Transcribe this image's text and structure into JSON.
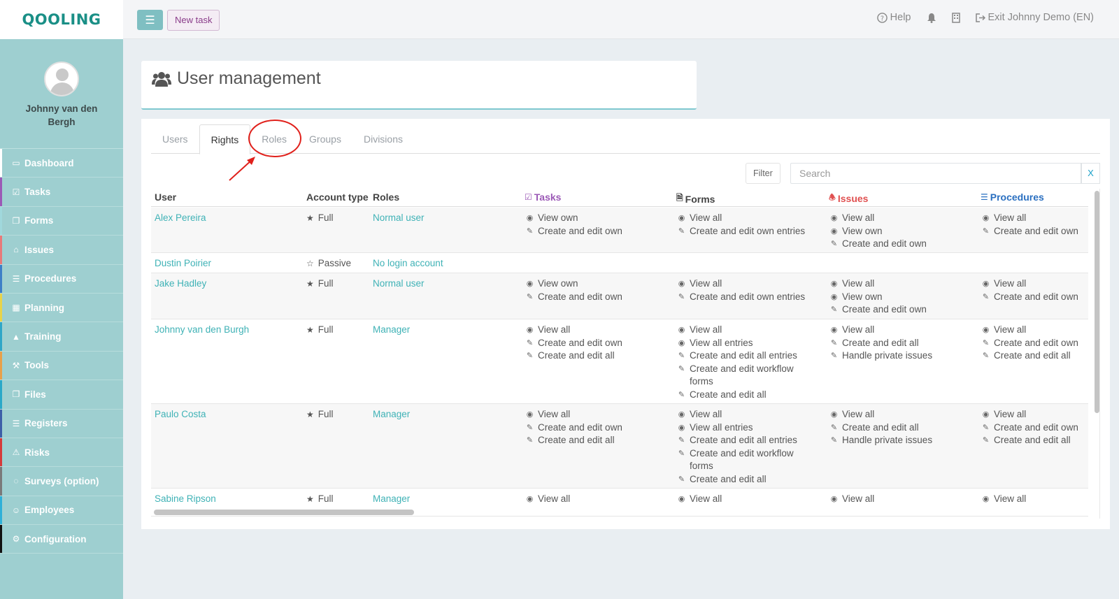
{
  "app": {
    "logo": "QOOLING"
  },
  "user_profile": {
    "name": "Johnny van den Bergh"
  },
  "sidebar": {
    "items": [
      {
        "label": "Dashboard",
        "icon": "desktop-icon",
        "stripe": "#ffffff"
      },
      {
        "label": "Tasks",
        "icon": "check-square-icon",
        "stripe": "#9b59b6"
      },
      {
        "label": "Forms",
        "icon": "file-icon",
        "stripe": "#a0d8dc"
      },
      {
        "label": "Issues",
        "icon": "bell-icon",
        "stripe": "#e87a7a"
      },
      {
        "label": "Procedures",
        "icon": "list-icon",
        "stripe": "#3d7fc7"
      },
      {
        "label": "Planning",
        "icon": "calendar-icon",
        "stripe": "#e8d34a"
      },
      {
        "label": "Training",
        "icon": "graduation-cap-icon",
        "stripe": "#2fa6c7"
      },
      {
        "label": "Tools",
        "icon": "wrench-icon",
        "stripe": "#e8a04a"
      },
      {
        "label": "Files",
        "icon": "file-icon",
        "stripe": "#2aa8c8"
      },
      {
        "label": "Registers",
        "icon": "list-icon",
        "stripe": "#3d5fa8"
      },
      {
        "label": "Risks",
        "icon": "warning-icon",
        "stripe": "#d63a3a"
      },
      {
        "label": "Surveys (option)",
        "icon": "comments-icon",
        "stripe": "#7a7a7a"
      },
      {
        "label": "Employees",
        "icon": "users-icon",
        "stripe": "#2fb0d8"
      },
      {
        "label": "Configuration",
        "icon": "gear-icon",
        "stripe": "#111111"
      }
    ]
  },
  "topbar": {
    "menu_icon": "hamburger-icon",
    "new_task_label": "New task",
    "help_label": "Help",
    "exit_label": "Exit Johnny Demo (EN)"
  },
  "page": {
    "title": "User management"
  },
  "tabs": [
    "Users",
    "Rights",
    "Roles",
    "Groups",
    "Divisions"
  ],
  "active_tab": "Rights",
  "filter_label": "Filter",
  "search": {
    "placeholder": "Search",
    "clear_label": "X"
  },
  "table": {
    "headers": {
      "user": "User",
      "account_type": "Account type",
      "roles": "Roles",
      "tasks": "Tasks",
      "forms": "Forms",
      "issues": "Issues",
      "procedures": "Procedures"
    },
    "header_colors": {
      "tasks": "#9b59b6",
      "forms": "#444444",
      "issues": "#e05050",
      "procedures": "#2a6fc0"
    },
    "rows": [
      {
        "user": "Alex Pereira",
        "account_type": "Full",
        "role": "Normal user",
        "tasks": [
          "View own",
          "Create and edit own"
        ],
        "forms": [
          "View all",
          "Create and edit own entries"
        ],
        "issues": [
          "View all",
          "View own",
          "Create and edit own"
        ],
        "procedures": [
          "View all",
          "Create and edit own"
        ]
      },
      {
        "user": "Dustin Poirier",
        "account_type": "Passive",
        "role": "No login account",
        "tasks": [],
        "forms": [],
        "issues": [],
        "procedures": []
      },
      {
        "user": "Jake Hadley",
        "account_type": "Full",
        "role": "Normal user",
        "tasks": [
          "View own",
          "Create and edit own"
        ],
        "forms": [
          "View all",
          "Create and edit own entries"
        ],
        "issues": [
          "View all",
          "View own",
          "Create and edit own"
        ],
        "procedures": [
          "View all",
          "Create and edit own"
        ]
      },
      {
        "user": "Johnny van den Burgh",
        "account_type": "Full",
        "role": "Manager",
        "tasks": [
          "View all",
          "Create and edit own",
          "Create and edit all"
        ],
        "forms": [
          "View all",
          "View all entries",
          "Create and edit all entries",
          "Create and edit workflow forms",
          "Create and edit all"
        ],
        "issues": [
          "View all",
          "Create and edit all",
          "Handle private issues"
        ],
        "procedures": [
          "View all",
          "Create and edit own",
          "Create and edit all"
        ]
      },
      {
        "user": "Paulo Costa",
        "account_type": "Full",
        "role": "Manager",
        "tasks": [
          "View all",
          "Create and edit own",
          "Create and edit all"
        ],
        "forms": [
          "View all",
          "View all entries",
          "Create and edit all entries",
          "Create and edit workflow forms",
          "Create and edit all"
        ],
        "issues": [
          "View all",
          "Create and edit all",
          "Handle private issues"
        ],
        "procedures": [
          "View all",
          "Create and edit own",
          "Create and edit all"
        ]
      },
      {
        "user": "Sabine Ripson",
        "account_type": "Full",
        "role": "Manager",
        "tasks": [
          "View all"
        ],
        "forms": [
          "View all"
        ],
        "issues": [
          "View all"
        ],
        "procedures": [
          "View all"
        ]
      }
    ]
  },
  "annotation": {
    "color": "#e0201b"
  }
}
